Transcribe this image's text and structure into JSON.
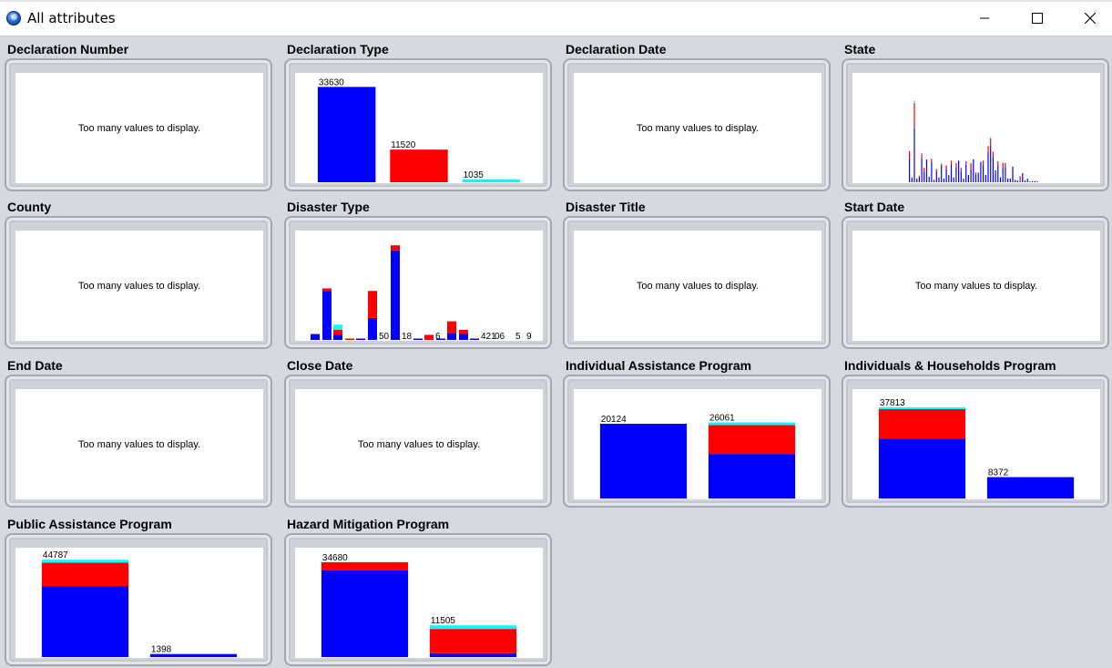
{
  "window": {
    "title": "All attributes"
  },
  "colors": {
    "blue": "#0000ff",
    "red": "#ff0000",
    "cyan": "#00ffff"
  },
  "panels": [
    {
      "id": "declaration-number",
      "title": "Declaration Number",
      "message": "Too many values to display."
    },
    {
      "id": "declaration-type",
      "title": "Declaration Type"
    },
    {
      "id": "declaration-date",
      "title": "Declaration Date",
      "message": "Too many values to display."
    },
    {
      "id": "state",
      "title": "State"
    },
    {
      "id": "county",
      "title": "County",
      "message": "Too many values to display."
    },
    {
      "id": "disaster-type",
      "title": "Disaster Type"
    },
    {
      "id": "disaster-title",
      "title": "Disaster Title",
      "message": "Too many values to display."
    },
    {
      "id": "start-date",
      "title": "Start Date",
      "message": "Too many values to display."
    },
    {
      "id": "end-date",
      "title": "End Date",
      "message": "Too many values to display."
    },
    {
      "id": "close-date",
      "title": "Close Date",
      "message": "Too many values to display."
    },
    {
      "id": "individual-assistance-program",
      "title": "Individual Assistance Program"
    },
    {
      "id": "individuals-households-program",
      "title": "Individuals & Households Program"
    },
    {
      "id": "public-assistance-program",
      "title": "Public Assistance Program"
    },
    {
      "id": "hazard-mitigation-program",
      "title": "Hazard Mitigation Program"
    }
  ],
  "chart_data": [
    {
      "panel": "declaration-type",
      "type": "bar",
      "ylim": [
        0,
        36000
      ],
      "bars": [
        {
          "label": "33630",
          "segments": [
            {
              "color": "blue",
              "value": 33630
            }
          ]
        },
        {
          "label": "11520",
          "segments": [
            {
              "color": "red",
              "value": 11520
            }
          ]
        },
        {
          "label": "1035",
          "segments": [
            {
              "color": "cyan",
              "value": 1035
            }
          ]
        }
      ]
    },
    {
      "panel": "state",
      "type": "bar",
      "ylim": [
        0,
        1700
      ],
      "bars": [
        {
          "blue": 400,
          "red": 120,
          "cyan": 0
        },
        {
          "blue": 80,
          "red": 0,
          "cyan": 0
        },
        {
          "blue": 900,
          "red": 420,
          "cyan": 45
        },
        {
          "blue": 60,
          "red": 0,
          "cyan": 0
        },
        {
          "blue": 90,
          "red": 20,
          "cyan": 0
        },
        {
          "blue": 400,
          "red": 80,
          "cyan": 0
        },
        {
          "blue": 180,
          "red": 60,
          "cyan": 0
        },
        {
          "blue": 380,
          "red": 0,
          "cyan": 0
        },
        {
          "blue": 90,
          "red": 0,
          "cyan": 0
        },
        {
          "blue": 330,
          "red": 60,
          "cyan": 0
        },
        {
          "blue": 40,
          "red": 0,
          "cyan": 0
        },
        {
          "blue": 180,
          "red": 40,
          "cyan": 0
        },
        {
          "blue": 80,
          "red": 0,
          "cyan": 0
        },
        {
          "blue": 280,
          "red": 30,
          "cyan": 0
        },
        {
          "blue": 60,
          "red": 0,
          "cyan": 0
        },
        {
          "blue": 220,
          "red": 60,
          "cyan": 0
        },
        {
          "blue": 120,
          "red": 0,
          "cyan": 0
        },
        {
          "blue": 300,
          "red": 60,
          "cyan": 0
        },
        {
          "blue": 80,
          "red": 0,
          "cyan": 0
        },
        {
          "blue": 250,
          "red": 70,
          "cyan": 0
        },
        {
          "blue": 360,
          "red": 0,
          "cyan": 0
        },
        {
          "blue": 180,
          "red": 60,
          "cyan": 0
        },
        {
          "blue": 60,
          "red": 0,
          "cyan": 0
        },
        {
          "blue": 300,
          "red": 50,
          "cyan": 0
        },
        {
          "blue": 120,
          "red": 0,
          "cyan": 0
        },
        {
          "blue": 220,
          "red": 100,
          "cyan": 0
        },
        {
          "blue": 380,
          "red": 0,
          "cyan": 0
        },
        {
          "blue": 120,
          "red": 40,
          "cyan": 0
        },
        {
          "blue": 160,
          "red": 0,
          "cyan": 0
        },
        {
          "blue": 340,
          "red": 0,
          "cyan": 0
        },
        {
          "blue": 280,
          "red": 80,
          "cyan": 0
        },
        {
          "blue": 120,
          "red": 0,
          "cyan": 0
        },
        {
          "blue": 500,
          "red": 100,
          "cyan": 0
        },
        {
          "blue": 600,
          "red": 130,
          "cyan": 25
        },
        {
          "blue": 420,
          "red": 90,
          "cyan": 0
        },
        {
          "blue": 200,
          "red": 0,
          "cyan": 0
        },
        {
          "blue": 280,
          "red": 70,
          "cyan": 0
        },
        {
          "blue": 80,
          "red": 0,
          "cyan": 0
        },
        {
          "blue": 250,
          "red": 70,
          "cyan": 0
        },
        {
          "blue": 250,
          "red": 70,
          "cyan": 0
        },
        {
          "blue": 60,
          "red": 0,
          "cyan": 0
        },
        {
          "blue": 60,
          "red": 0,
          "cyan": 0
        },
        {
          "blue": 260,
          "red": 0,
          "cyan": 0
        },
        {
          "blue": 40,
          "red": 0,
          "cyan": 0
        },
        {
          "blue": 30,
          "red": 0,
          "cyan": 0
        },
        {
          "blue": 20,
          "red": 80,
          "cyan": 0
        },
        {
          "blue": 150,
          "red": 0,
          "cyan": 0
        },
        {
          "blue": 30,
          "red": 0,
          "cyan": 0
        },
        {
          "blue": 60,
          "red": 0,
          "cyan": 0
        },
        {
          "blue": 10,
          "red": 0,
          "cyan": 0
        },
        {
          "blue": 20,
          "red": 0,
          "cyan": 0
        },
        {
          "blue": 20,
          "red": 0,
          "cyan": 0
        },
        {
          "blue": 10,
          "red": 0,
          "cyan": 0
        }
      ]
    },
    {
      "panel": "disaster-type",
      "type": "bar",
      "ylim": [
        0,
        11000
      ],
      "bars": [
        {
          "label": "",
          "segments": [
            {
              "color": "blue",
              "value": 700
            }
          ]
        },
        {
          "label": "",
          "segments": [
            {
              "color": "blue",
              "value": 5800
            },
            {
              "color": "red",
              "value": 300
            }
          ]
        },
        {
          "label": "",
          "segments": [
            {
              "color": "blue",
              "value": 600
            },
            {
              "color": "red",
              "value": 600
            },
            {
              "color": "cyan",
              "value": 600
            }
          ]
        },
        {
          "label": "",
          "segments": [
            {
              "color": "red",
              "value": 150
            }
          ]
        },
        {
          "label": "",
          "segments": [
            {
              "color": "blue",
              "value": 80
            }
          ]
        },
        {
          "label": "50",
          "segments": [
            {
              "color": "blue",
              "value": 2600
            },
            {
              "color": "red",
              "value": 3200
            }
          ]
        },
        {
          "label": "18",
          "segments": [
            {
              "color": "blue",
              "value": 10600
            },
            {
              "color": "red",
              "value": 600
            }
          ]
        },
        {
          "label": "",
          "segments": [
            {
              "color": "blue",
              "value": 60
            }
          ]
        },
        {
          "label": "6",
          "segments": [
            {
              "color": "red",
              "value": 600
            }
          ]
        },
        {
          "label": "",
          "segments": [
            {
              "color": "blue",
              "value": 60
            }
          ]
        },
        {
          "label": "",
          "segments": [
            {
              "color": "blue",
              "value": 800
            },
            {
              "color": "red",
              "value": 1400
            }
          ]
        },
        {
          "label": "",
          "segments": [
            {
              "color": "blue",
              "value": 700
            },
            {
              "color": "red",
              "value": 500
            }
          ]
        },
        {
          "label": "421",
          "segments": [
            {
              "color": "blue",
              "value": 150
            }
          ]
        }
      ],
      "extra_labels": [
        "06",
        "5",
        "9"
      ]
    },
    {
      "panel": "individual-assistance-program",
      "type": "bar",
      "ylim": [
        0,
        27500
      ],
      "bars": [
        {
          "label": "20124",
          "segments": [
            {
              "color": "blue",
              "value": 20124
            }
          ]
        },
        {
          "label": "26061",
          "segments": [
            {
              "color": "blue",
              "value": 12000
            },
            {
              "color": "red",
              "value": 7800
            },
            {
              "color": "cyan",
              "value": 700
            }
          ]
        }
      ]
    },
    {
      "panel": "individuals-households-program",
      "type": "bar",
      "ylim": [
        0,
        40000
      ],
      "bars": [
        {
          "label": "37813",
          "segments": [
            {
              "color": "blue",
              "value": 23500
            },
            {
              "color": "red",
              "value": 11500
            },
            {
              "color": "cyan",
              "value": 700
            }
          ]
        },
        {
          "label": "8372",
          "segments": [
            {
              "color": "blue",
              "value": 8372
            }
          ]
        }
      ]
    },
    {
      "panel": "public-assistance-program",
      "type": "bar",
      "ylim": [
        0,
        47000
      ],
      "bars": [
        {
          "label": "44787",
          "segments": [
            {
              "color": "blue",
              "value": 32700
            },
            {
              "color": "red",
              "value": 10800
            },
            {
              "color": "cyan",
              "value": 1300
            }
          ]
        },
        {
          "label": "1398",
          "segments": [
            {
              "color": "blue",
              "value": 1398
            }
          ]
        }
      ]
    },
    {
      "panel": "hazard-mitigation-program",
      "type": "bar",
      "ylim": [
        0,
        37000
      ],
      "bars": [
        {
          "label": "34680",
          "segments": [
            {
              "color": "blue",
              "value": 31500
            },
            {
              "color": "red",
              "value": 2900
            }
          ]
        },
        {
          "label": "11505",
          "segments": [
            {
              "color": "blue",
              "value": 1400
            },
            {
              "color": "red",
              "value": 8800
            },
            {
              "color": "cyan",
              "value": 1305
            }
          ]
        }
      ]
    }
  ]
}
